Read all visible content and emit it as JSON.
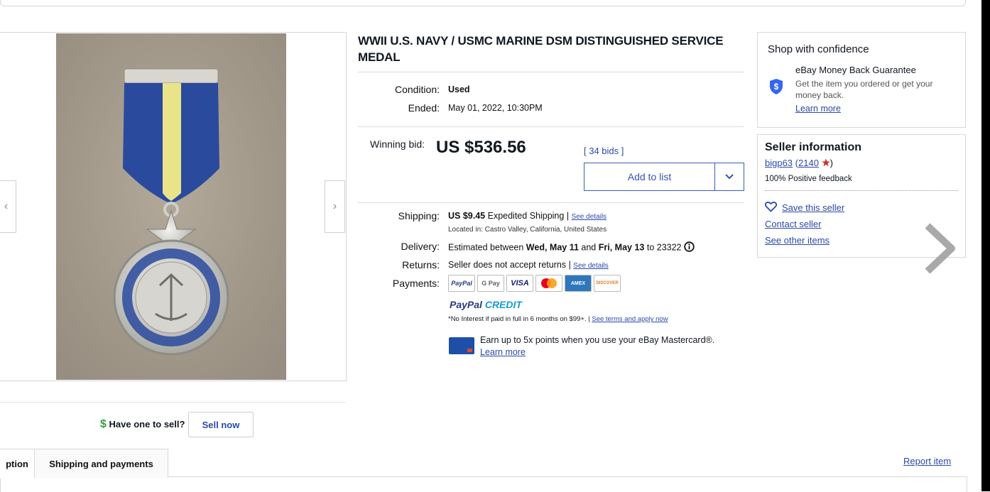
{
  "listing": {
    "title": "WWII U.S. NAVY / USMC MARINE DSM DISTINGUISHED SERVICE MEDAL",
    "condition_label": "Condition:",
    "condition_value": "Used",
    "ended_label": "Ended:",
    "ended_value": "May 01, 2022, 10:30PM",
    "winning_bid_label": "Winning bid:",
    "winning_bid_value": "US $536.56",
    "bids_link": "[ 34 bids ]",
    "add_to_list_label": "Add to list"
  },
  "shipping": {
    "shipping_label": "Shipping:",
    "shipping_price": "US $9.45",
    "shipping_method": "Expedited Shipping",
    "shipping_sep": "|",
    "see_details": "See details",
    "located_in": "Located in: Castro Valley, California, United States",
    "delivery_label": "Delivery:",
    "delivery_prefix": "Estimated between",
    "delivery_start": "Wed, May 11",
    "delivery_and": "and",
    "delivery_end": "Fri, May 13",
    "delivery_to": "to 23322",
    "returns_label": "Returns:",
    "returns_value": "Seller does not accept returns",
    "returns_sep": "|",
    "returns_link": "See details",
    "payments_label": "Payments:",
    "payment_logos": [
      "PayPal",
      "G Pay",
      "VISA",
      "",
      "AMEX",
      "DISCOVER"
    ],
    "paypal_credit_a": "PayPal",
    "paypal_credit_b": "CREDIT",
    "credit_note": "*No Interest if paid in full in 6 months on $99+. |",
    "credit_link": "See terms and apply now",
    "mastercard_offer": "Earn up to 5x points when you use your eBay Mastercard®.",
    "mastercard_link": "Learn more"
  },
  "confidence": {
    "heading": "Shop with confidence",
    "guarantee_title": "eBay Money Back Guarantee",
    "guarantee_text": "Get the item you ordered or get your money back.",
    "learn_more": "Learn more"
  },
  "seller": {
    "heading": "Seller information",
    "username": "bigp63",
    "feedback_open": "(",
    "feedback_count": "2140",
    "feedback_close": ")",
    "positive": "100% Positive feedback",
    "save": "Save this seller",
    "contact": "Contact seller",
    "other_items": "See other items"
  },
  "sell": {
    "prompt": "Have one to sell?",
    "button": "Sell now"
  },
  "tabs": {
    "description": "ption",
    "shipping_payments": "Shipping and payments",
    "report_item": "Report item"
  },
  "colors": {
    "link": "#2a4aa8",
    "ribbon_blue": "#2a4a9e",
    "ribbon_yellow": "#e9e48a",
    "photo_bg": "#a49a8e"
  },
  "icons": [
    "chevron-left-icon",
    "chevron-right-icon",
    "chevron-down-icon",
    "shield-dollar-icon",
    "info-icon",
    "heart-icon",
    "star-icon",
    "dollar-icon",
    "carousel-next-icon"
  ]
}
